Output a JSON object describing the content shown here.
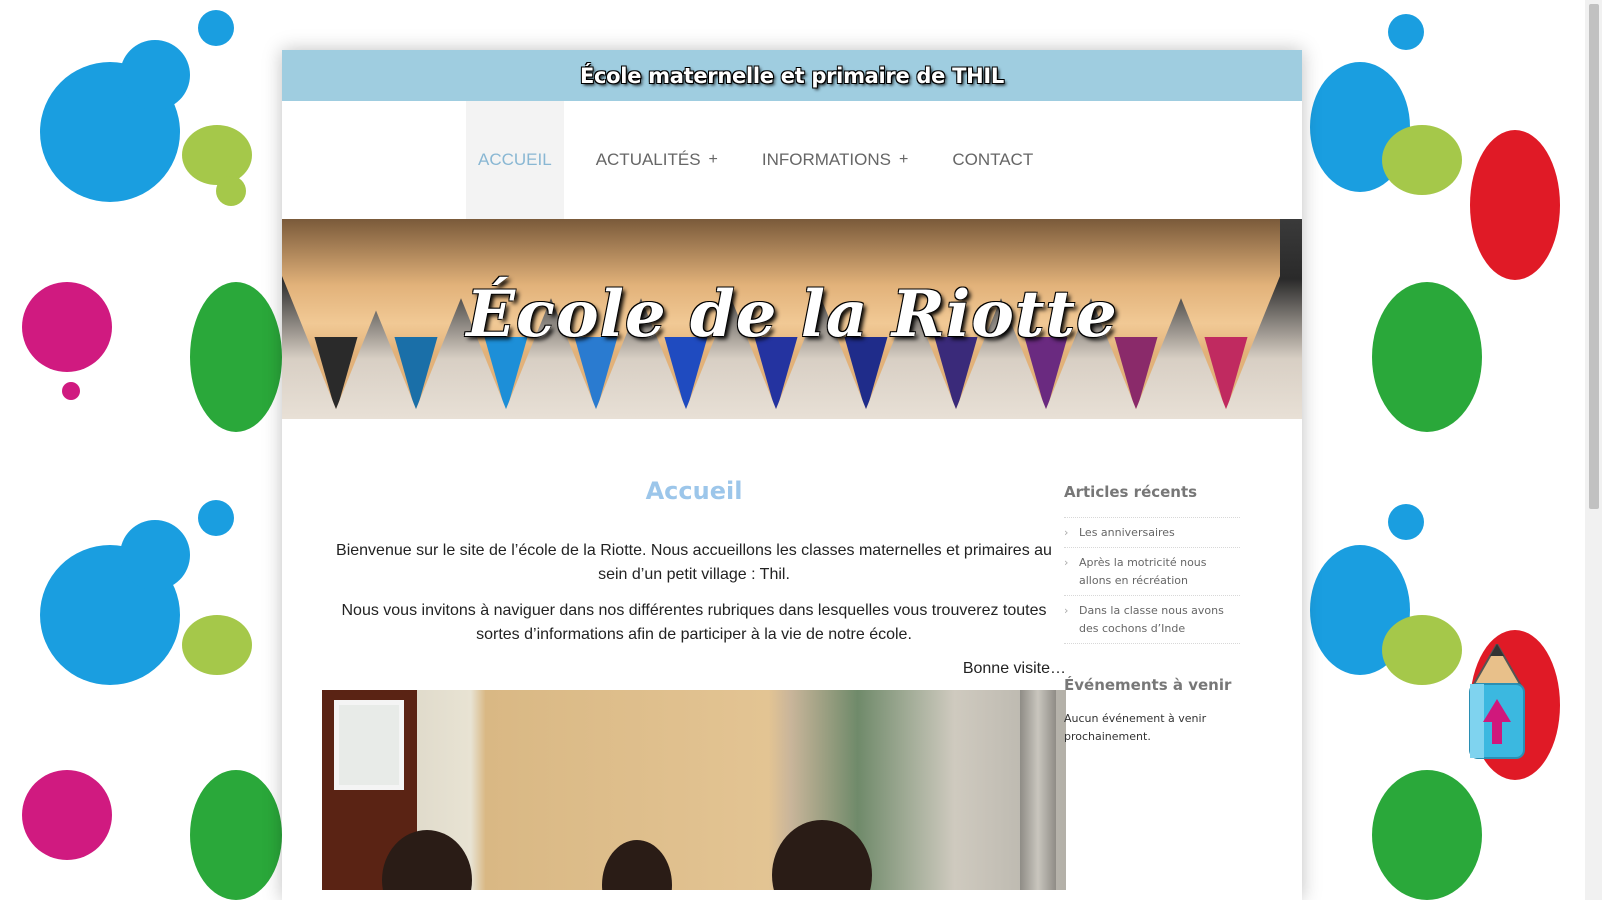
{
  "site": {
    "header_title": "École maternelle et primaire de THIL",
    "banner_title": "École de la Riotte"
  },
  "nav": {
    "items": [
      {
        "label": "ACCUEIL",
        "active": true,
        "has_submenu": false
      },
      {
        "label": "ACTUALITÉS",
        "active": false,
        "has_submenu": true
      },
      {
        "label": "INFORMATIONS",
        "active": false,
        "has_submenu": true
      },
      {
        "label": "CONTACT",
        "active": false,
        "has_submenu": false
      }
    ],
    "submenu_icon": "+"
  },
  "main": {
    "heading": "Accueil",
    "paragraphs": [
      "Bienvenue sur le site de l’école de la Riotte. Nous accueillons les classes maternelles et primaires au sein d’un petit village : Thil.",
      "Nous vous invitons à naviguer dans nos différentes rubriques dans lesquelles vous trouverez toutes sortes d’informations afin de participer à la vie de notre école."
    ],
    "signoff": "Bonne visite…"
  },
  "sidebar": {
    "recent_heading": "Articles récents",
    "recent_articles": [
      "Les anniversaires",
      "Après la motricité nous allons en récréation",
      "Dans la classe nous avons des cochons d’Inde"
    ],
    "events_heading": "Événements à venir",
    "events_text": "Aucun événement à venir prochainement."
  },
  "colors": {
    "topbar": "#9fcde0",
    "active_nav": "#89b7d3",
    "heading": "#9cc6ea",
    "scroll_top_arrow": "#d0187c"
  },
  "icons": {
    "chevron": "chevron-right-icon",
    "scroll_top": "pencil-arrow-up-icon"
  }
}
